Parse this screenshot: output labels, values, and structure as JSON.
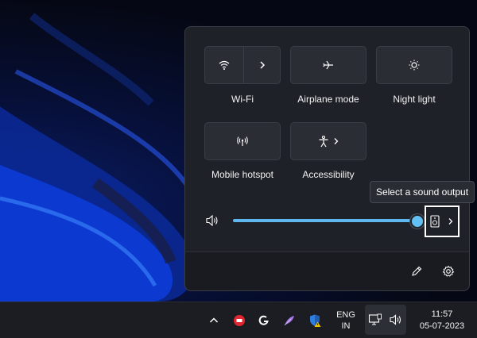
{
  "quick_settings": {
    "tiles": [
      {
        "id": "wifi",
        "label": "Wi-Fi",
        "icon": "wifi-icon"
      },
      {
        "id": "airplane",
        "label": "Airplane mode",
        "icon": "airplane-icon"
      },
      {
        "id": "night",
        "label": "Night light",
        "icon": "night-light-icon"
      },
      {
        "id": "hotspot",
        "label": "Mobile hotspot",
        "icon": "hotspot-icon"
      },
      {
        "id": "accessibility",
        "label": "Accessibility",
        "icon": "accessibility-icon"
      }
    ],
    "volume": {
      "level": 0.98,
      "icon": "speaker-icon"
    },
    "sound_output_tooltip": "Select a sound output",
    "footer": {
      "edit_icon": "pencil-icon",
      "settings_icon": "gear-icon"
    }
  },
  "taskbar": {
    "language": {
      "line1": "ENG",
      "line2": "IN"
    },
    "clock": {
      "time": "11:57",
      "date": "05-07-2023"
    },
    "tray_icons": [
      "chevron-up-icon",
      "app-red-icon",
      "logitech-g-icon",
      "feather-icon",
      "defender-warning-icon",
      "network-icon",
      "volume-icon"
    ]
  },
  "colors": {
    "accent": "#5fb7f0",
    "panel": "#1f2128",
    "taskbar": "#1c1d22"
  }
}
